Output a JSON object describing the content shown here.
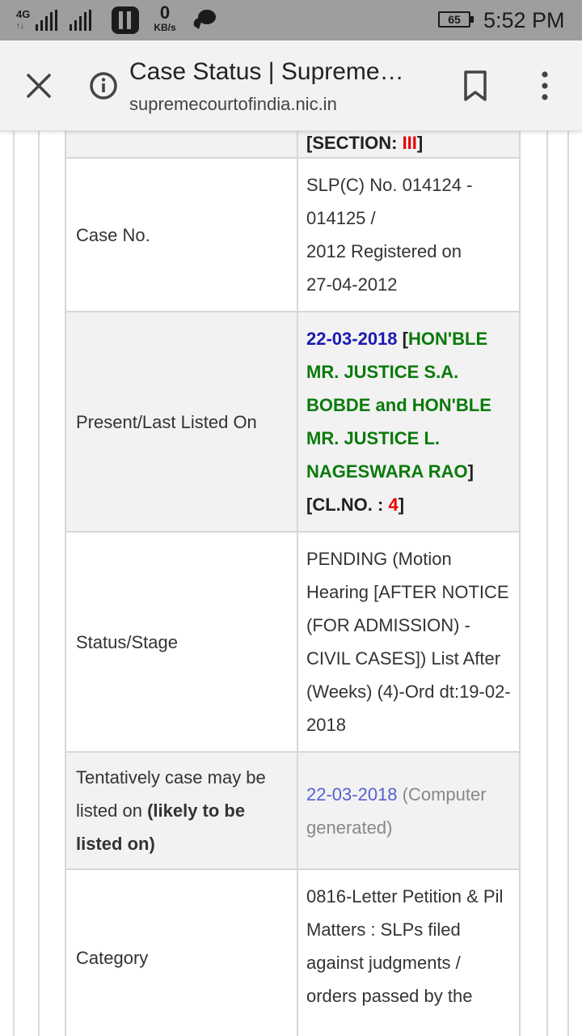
{
  "status_bar": {
    "network": "4G",
    "speed_value": "0",
    "speed_unit": "KB/s",
    "battery": "65",
    "time": "5:52 PM"
  },
  "toolbar": {
    "title": "Case Status | Supreme…",
    "url": "supremecourtofindia.nic.in"
  },
  "table": {
    "section_row": {
      "prefix": "[SECTION: ",
      "value": "III",
      "suffix": "]"
    },
    "case_no": {
      "label": "Case No.",
      "lines": [
        "SLP(C) No. 014124 -",
        "014125 /",
        "2012  Registered on",
        "27-04-2012"
      ]
    },
    "listed_on": {
      "label": "Present/Last Listed On",
      "date": "22-03-2018",
      "open_bracket": " [",
      "bench": "HON'BLE MR. JUSTICE S.A. BOBDE and HON'BLE MR. JUSTICE L. NAGESWARA RAO",
      "close_bracket": "]",
      "clno_prefix": "[CL.NO. : ",
      "clno_value": "4",
      "clno_suffix": "]"
    },
    "status": {
      "label": "Status/Stage",
      "text": "PENDING (Motion Hearing [AFTER NOTICE (FOR ADMISSION) - CIVIL CASES]) List After (Weeks) (4)-Ord dt:19-02-2018"
    },
    "tentative": {
      "label": "Tentatively case may be listed on ",
      "label_bold": "(likely to be listed on)",
      "date": "22-03-2018",
      "note": " (Computer generated)"
    },
    "category": {
      "label": "Category",
      "text": "0816-Letter Petition & Pil Matters : SLPs filed against judgments / orders passed by the"
    }
  }
}
